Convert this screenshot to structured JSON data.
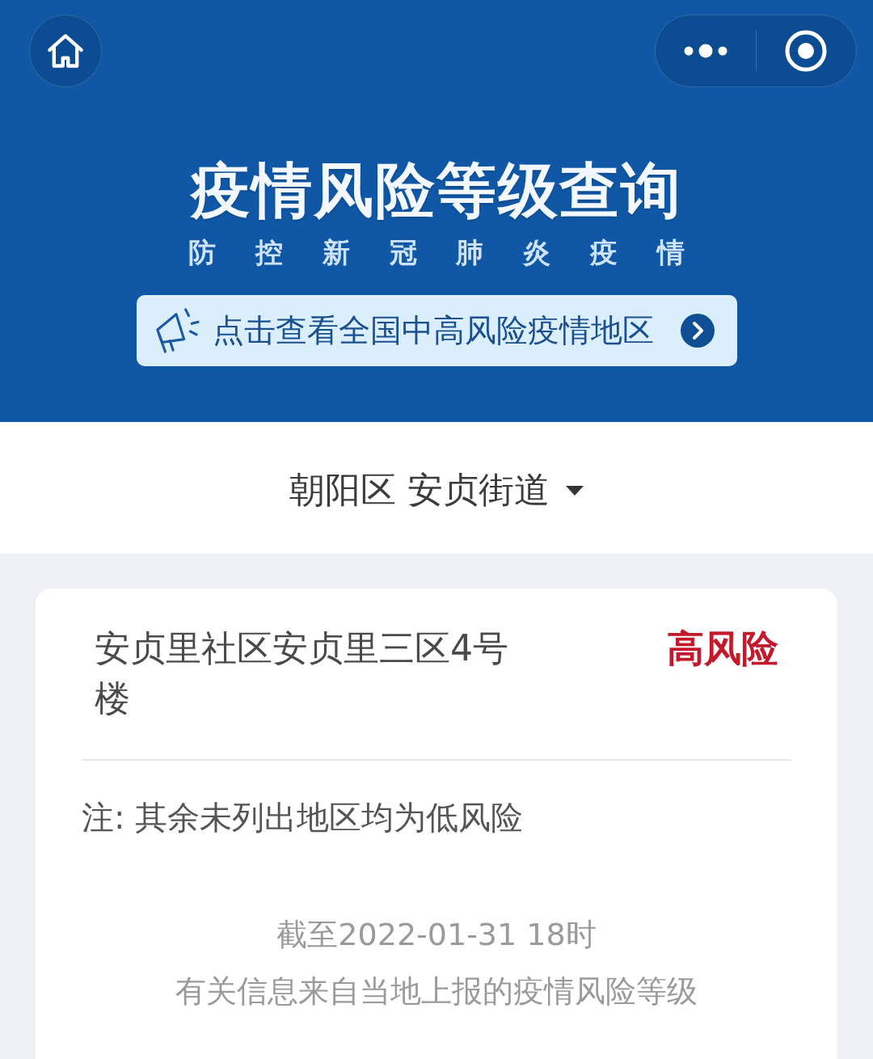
{
  "header": {
    "title": "疫情风险等级查询",
    "subtitle": "防 控 新 冠 肺 炎 疫 情",
    "banner_link": "点击查看全国中高风险疫情地区"
  },
  "location_selector": {
    "value": "朝阳区 安贞街道"
  },
  "results": [
    {
      "area": "安贞里社区安贞里三区4号楼",
      "risk": "高风险",
      "kind": "high"
    }
  ],
  "note": "注: 其余未列出地区均为低风险",
  "footer": {
    "updated": "截至2022-01-31 18时",
    "source": "有关信息来自当地上报的疫情风险等级"
  }
}
